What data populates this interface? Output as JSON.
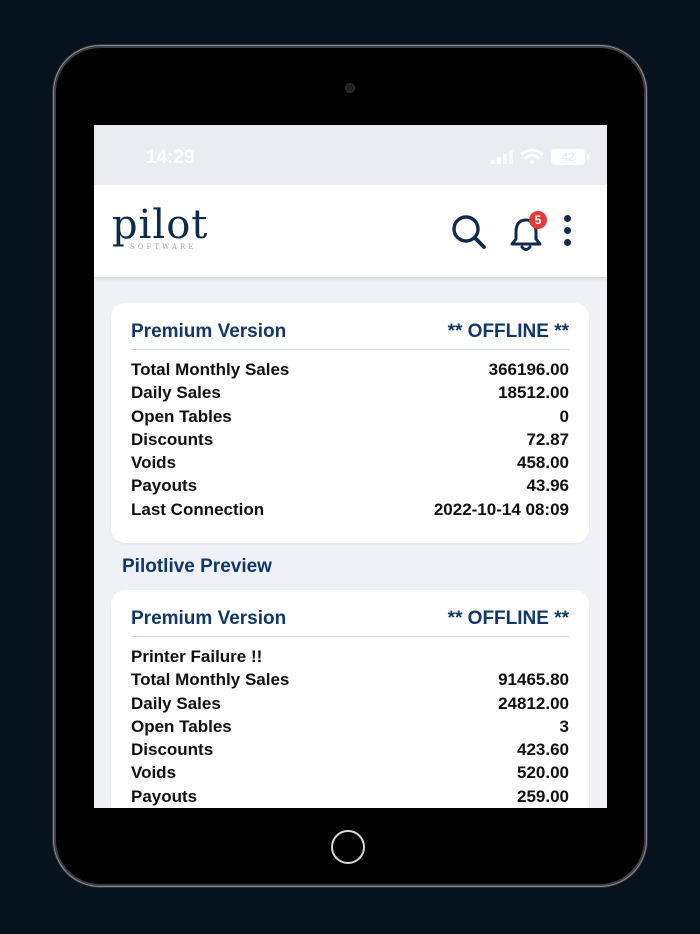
{
  "status_bar": {
    "time": "14:29",
    "battery": "42"
  },
  "app_bar": {
    "logo_text": "pilot",
    "logo_subtitle": "SOFTWARE",
    "notification_count": "5"
  },
  "cards": [
    {
      "version": "Premium Version",
      "status": "** OFFLINE **",
      "rows": [
        {
          "label": "Total Monthly Sales",
          "value": "366196.00"
        },
        {
          "label": "Daily Sales",
          "value": "18512.00"
        },
        {
          "label": "Open Tables",
          "value": "0"
        },
        {
          "label": "Discounts",
          "value": "72.87"
        },
        {
          "label": "Voids",
          "value": "458.00"
        },
        {
          "label": "Payouts",
          "value": "43.96"
        },
        {
          "label": "Last Connection",
          "value": "2022-10-14 08:09"
        }
      ]
    },
    {
      "section_title": "Pilotlive Preview",
      "version": "Premium Version",
      "status": "** OFFLINE **",
      "alert": "Printer Failure !!",
      "rows": [
        {
          "label": "Total Monthly Sales",
          "value": "91465.80"
        },
        {
          "label": "Daily Sales",
          "value": "24812.00"
        },
        {
          "label": "Open Tables",
          "value": "3"
        },
        {
          "label": "Discounts",
          "value": "423.60"
        },
        {
          "label": "Voids",
          "value": "520.00"
        },
        {
          "label": "Payouts",
          "value": "259.00"
        }
      ]
    }
  ],
  "colors": {
    "navy": "#12386a",
    "badge": "#e23b3b",
    "background": "#eef1f5"
  }
}
